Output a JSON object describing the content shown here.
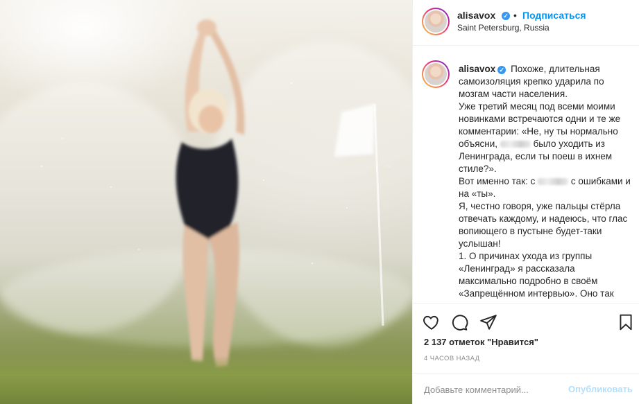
{
  "post": {
    "username": "alisavox",
    "follow_label": "Подписаться",
    "separator": "•",
    "location": "Saint Petersburg, Russia",
    "verified_icon": "verified-badge-icon",
    "caption_lines": [
      "Похоже, длительная самоизоляция крепко ударила по мозгам части населения.",
      "Уже третий месяц под всеми моими новинками встречаются одни и те же комментарии: «Не, ну ты нормально объясни,",
      "было уходить из Ленинграда, если ты поеш в ихнем стиле?».",
      "Вот именно так: с",
      "с ошибками и на «ты».",
      "Я, честно говоря, уже пальцы стёрла отвечать каждому, и надеюсь, что глас вопиющего в пустыне будет-таки услышан!",
      "1. О причинах ухода из группы «Ленинград» я рассказала максимально подробно в своём «Запрещённом интервью». Оно так"
    ],
    "likes": "2 137 отметок \"Нравится\"",
    "time": "4 ЧАСОВ НАЗАД",
    "comment_placeholder": "Добавьте комментарий...",
    "publish_label": "Опубликовать",
    "colors": {
      "link_blue": "#0095f6",
      "verified_blue": "#3897f0",
      "publish_disabled": "#b2dffc",
      "muted_text": "#8e8e8e"
    },
    "icons": [
      "heart-icon",
      "comment-icon",
      "share-icon",
      "bookmark-icon"
    ]
  }
}
